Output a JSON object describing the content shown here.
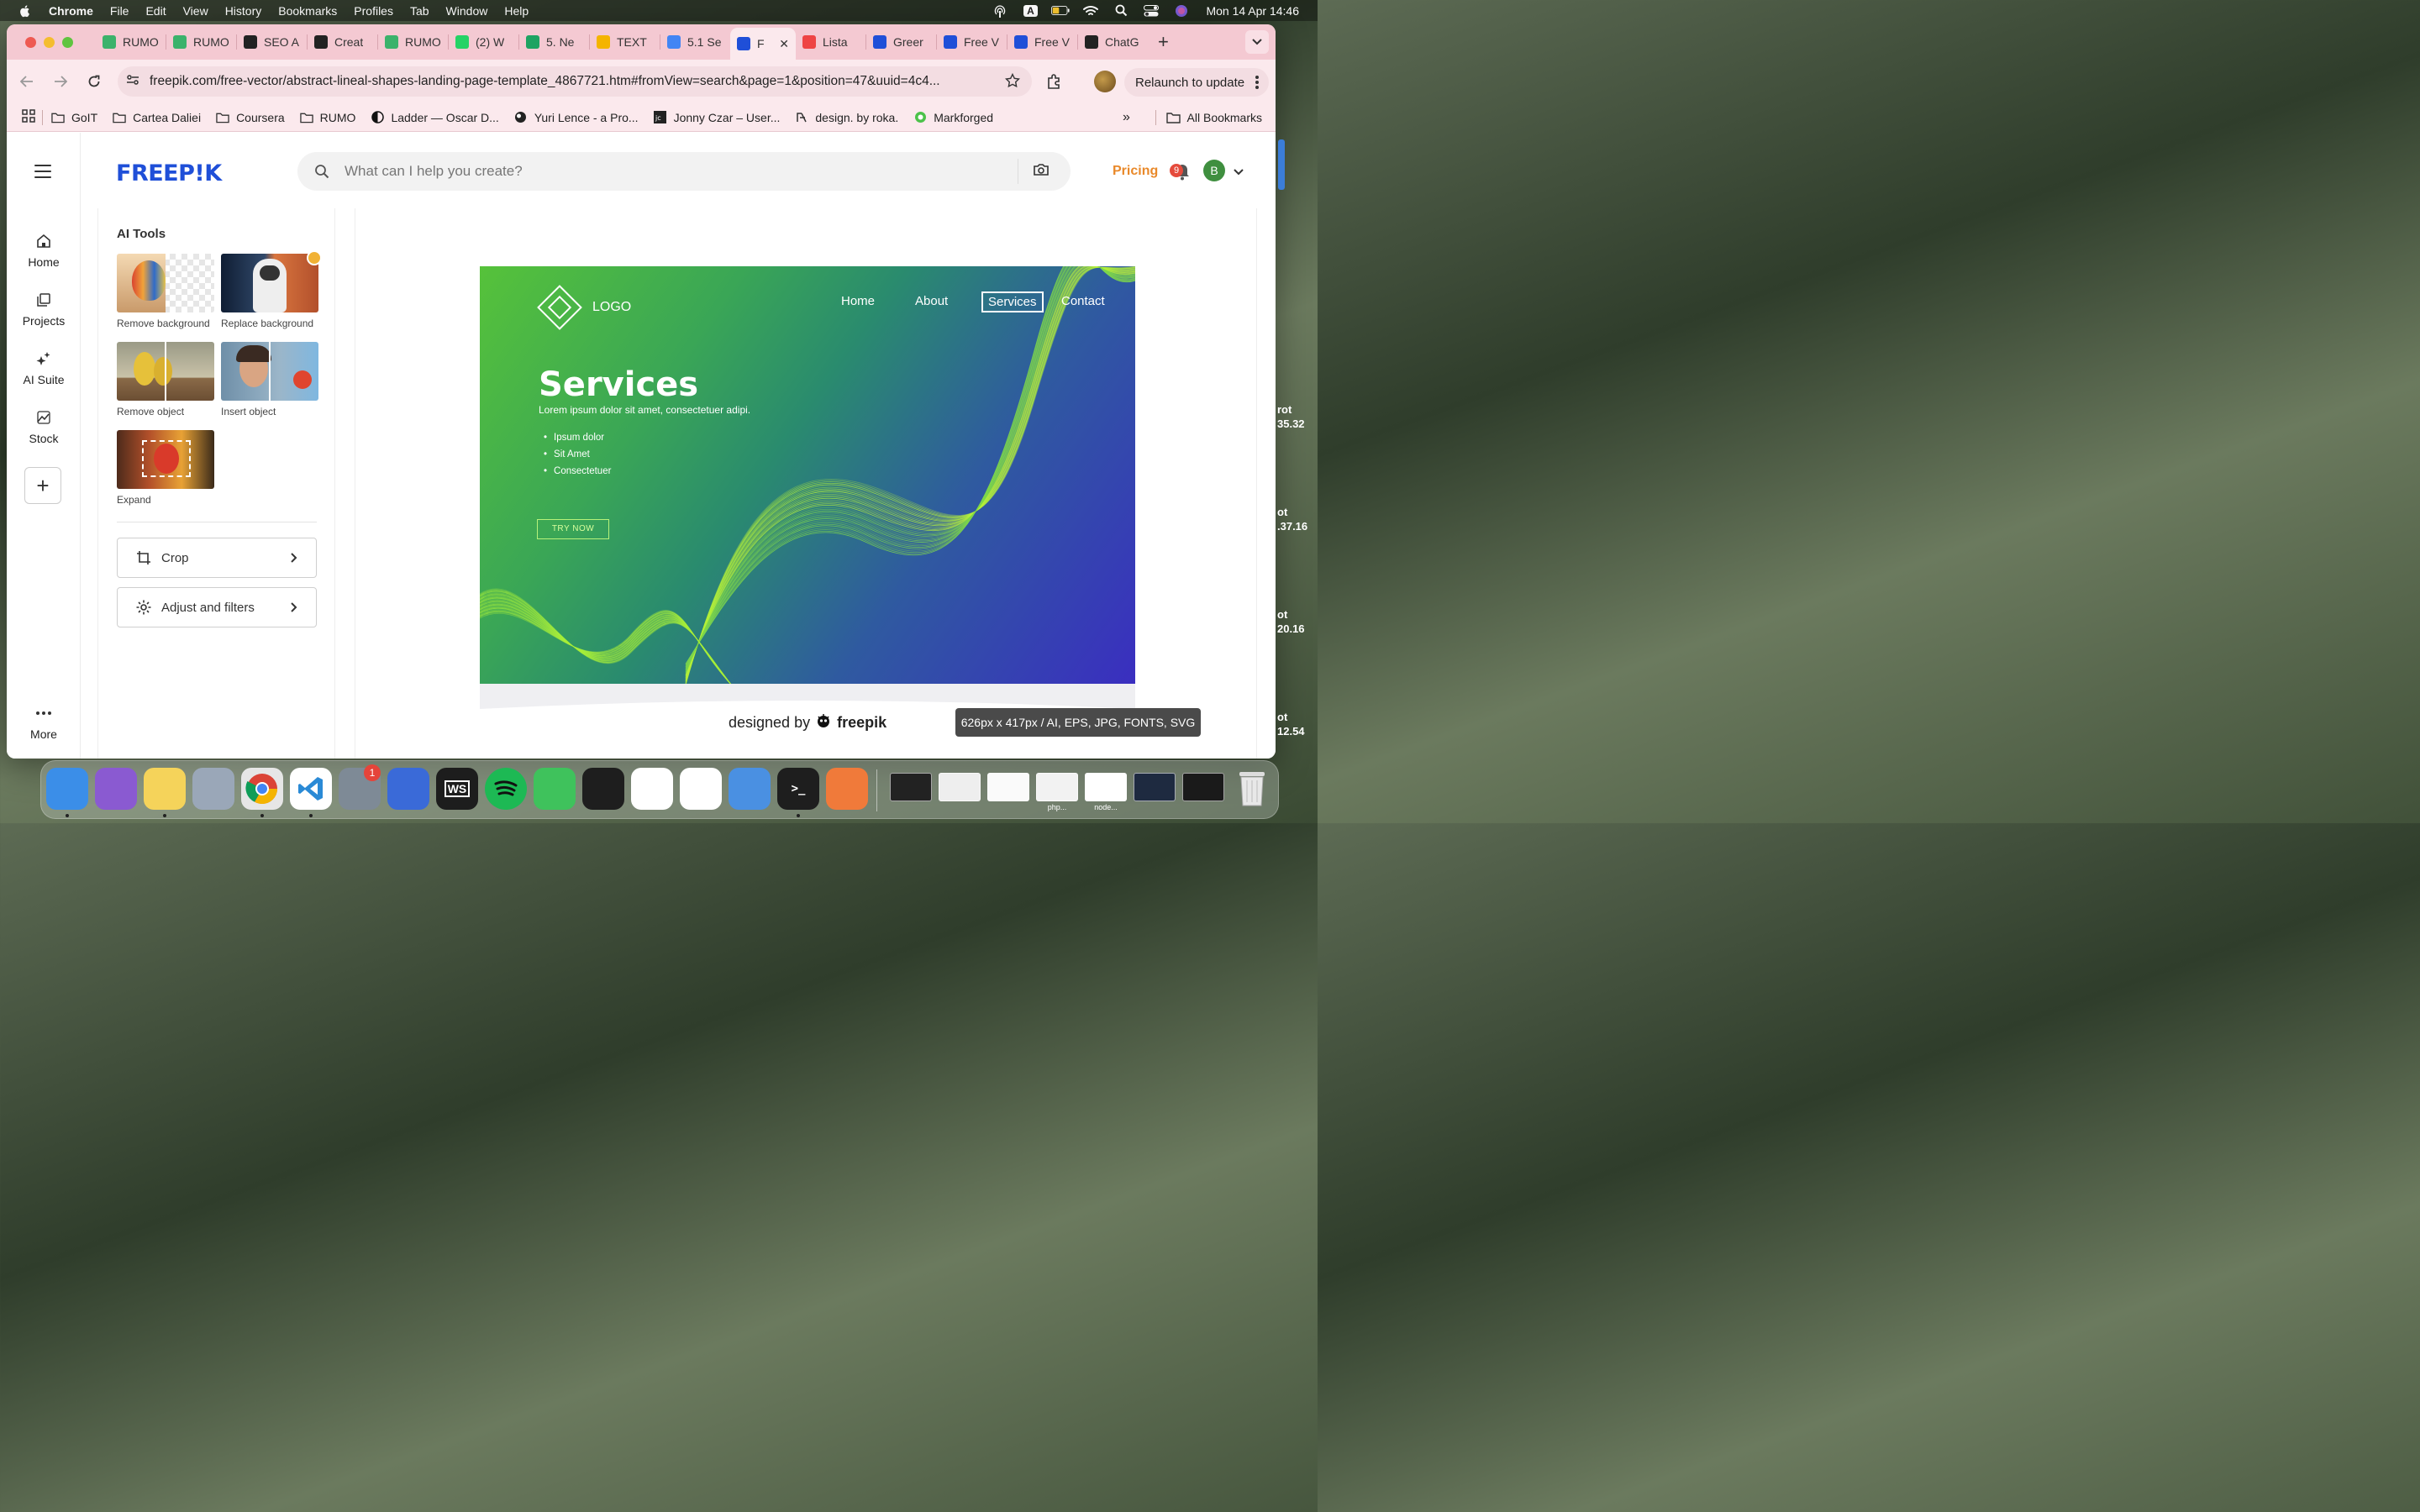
{
  "menubar": {
    "app": "Chrome",
    "items": [
      "File",
      "Edit",
      "View",
      "History",
      "Bookmarks",
      "Profiles",
      "Tab",
      "Window",
      "Help"
    ],
    "input_indicator": "A",
    "clock": "Mon 14 Apr  14:46"
  },
  "tabs": [
    {
      "label": "RUMO",
      "icon": "rumo-m-icon",
      "color": "#3bb26b"
    },
    {
      "label": "RUMO",
      "icon": "rumo-m-icon",
      "color": "#3bb26b"
    },
    {
      "label": "SEO A",
      "icon": "seo-icon",
      "color": "#222222"
    },
    {
      "label": "Creat",
      "icon": "openai-icon",
      "color": "#222222"
    },
    {
      "label": "RUMO",
      "icon": "rumo-m-icon",
      "color": "#3bb26b"
    },
    {
      "label": "(2) W",
      "icon": "whatsapp-icon",
      "color": "#25d366"
    },
    {
      "label": "5. Ne",
      "icon": "sheets-icon",
      "color": "#1ea362"
    },
    {
      "label": "TEXT",
      "icon": "drive-icon",
      "color": "#f4b400"
    },
    {
      "label": "5.1 Se",
      "icon": "docs-icon",
      "color": "#4285f4"
    },
    {
      "label": "F",
      "icon": "freepik-icon",
      "color": "#1f4fd8",
      "active": true
    },
    {
      "label": "Lista",
      "icon": "lista-icon",
      "color": "#e44"
    },
    {
      "label": "Greer",
      "icon": "freepik-icon",
      "color": "#1f4fd8"
    },
    {
      "label": "Free V",
      "icon": "freepik-icon",
      "color": "#1f4fd8"
    },
    {
      "label": "Free V",
      "icon": "freepik-icon",
      "color": "#1f4fd8"
    },
    {
      "label": "ChatG",
      "icon": "openai-icon",
      "color": "#222222"
    }
  ],
  "toolbar": {
    "url": "freepik.com/free-vector/abstract-lineal-shapes-landing-page-template_4867721.htm#fromView=search&page=1&position=47&uuid=4c4...",
    "relaunch_label": "Relaunch to update"
  },
  "bookmarks": [
    {
      "label": "GoIT",
      "icon": "folder-icon"
    },
    {
      "label": "Cartea Daliei",
      "icon": "folder-icon"
    },
    {
      "label": "Coursera",
      "icon": "folder-icon"
    },
    {
      "label": "RUMO",
      "icon": "folder-icon"
    },
    {
      "label": "Ladder — Oscar D...",
      "icon": "ladder-icon"
    },
    {
      "label": "Yuri Lence - a Pro...",
      "icon": "globe-icon"
    },
    {
      "label": "Jonny Czar – User...",
      "icon": "jc-icon"
    },
    {
      "label": "design. by roka.",
      "icon": "roka-icon"
    },
    {
      "label": "Markforged",
      "icon": "markforged-icon"
    }
  ],
  "bookmarks_more": "»",
  "all_bookmarks": "All Bookmarks",
  "leftnav": [
    {
      "label": "Home",
      "icon": "home-icon"
    },
    {
      "label": "Projects",
      "icon": "projects-icon"
    },
    {
      "label": "AI Suite",
      "icon": "sparkles-icon"
    },
    {
      "label": "Stock",
      "icon": "stock-icon"
    }
  ],
  "leftnav_more": "More",
  "header": {
    "logo": "FREEP!K",
    "search_placeholder": "What can I help you create?",
    "pricing": "Pricing",
    "notifications": "9",
    "avatar_initial": "B"
  },
  "ai_tools": {
    "title": "AI Tools",
    "items": [
      {
        "label": "Remove background"
      },
      {
        "label": "Replace background"
      },
      {
        "label": "Remove object"
      },
      {
        "label": "Insert object"
      },
      {
        "label": "Expand"
      }
    ],
    "crop": "Crop",
    "adjust": "Adjust and filters"
  },
  "preview": {
    "logo_text": "LOGO",
    "nav": [
      "Home",
      "About",
      "Services",
      "Contact"
    ],
    "title": "Services",
    "subtitle": "Lorem ipsum dolor sit amet, consectetuer adipi.",
    "bullets": [
      "Ipsum dolor",
      "Sit Amet",
      "Consectetuer"
    ],
    "cta": "TRY NOW",
    "designed_by": "designed by",
    "brand": "freepik",
    "specs": "626px x 417px / AI, EPS, JPG, FONTS, SVG"
  },
  "desktop_labels": [
    {
      "line1": "rot",
      "line2": "35.32"
    },
    {
      "line1": "ot",
      "line2": ".37.16"
    },
    {
      "line1": "ot",
      "line2": "20.16"
    },
    {
      "line1": "ot",
      "line2": "12.54"
    }
  ],
  "dock": {
    "apps": [
      {
        "name": "finder",
        "color": "#3b8ee8"
      },
      {
        "name": "affinity",
        "color": "#8a5ad1"
      },
      {
        "name": "notes",
        "color": "#f5d35a"
      },
      {
        "name": "launchpad",
        "color": "#9aa7b8"
      },
      {
        "name": "chrome",
        "color": "#e6e6e6"
      },
      {
        "name": "vscode",
        "color": "#ffffff"
      },
      {
        "name": "system-settings",
        "color": "#7e8a96"
      },
      {
        "name": "xcode-instruments",
        "color": "#3a6ad8"
      },
      {
        "name": "webstorm",
        "color": "#1d1d1d"
      },
      {
        "name": "spotify",
        "color": "#1db954"
      },
      {
        "name": "facetime",
        "color": "#3fc25c"
      },
      {
        "name": "figma",
        "color": "#1e1e1e"
      },
      {
        "name": "app-store",
        "color": "#ffffff"
      },
      {
        "name": "teams",
        "color": "#ffffff"
      },
      {
        "name": "xcode",
        "color": "#4a90e2"
      },
      {
        "name": "terminal",
        "color": "#1e1e1e"
      },
      {
        "name": "sketchbook",
        "color": "#f07a3a"
      }
    ],
    "settings_badge": "1",
    "thumb_labels": [
      "php...",
      "node..."
    ],
    "webstorm_label": "WS"
  },
  "colors": {
    "tab_strip": "#f4c9d2",
    "toolbar": "#fbe9ed",
    "freepik_blue": "#1f4fd8",
    "pricing": "#e9892a"
  }
}
